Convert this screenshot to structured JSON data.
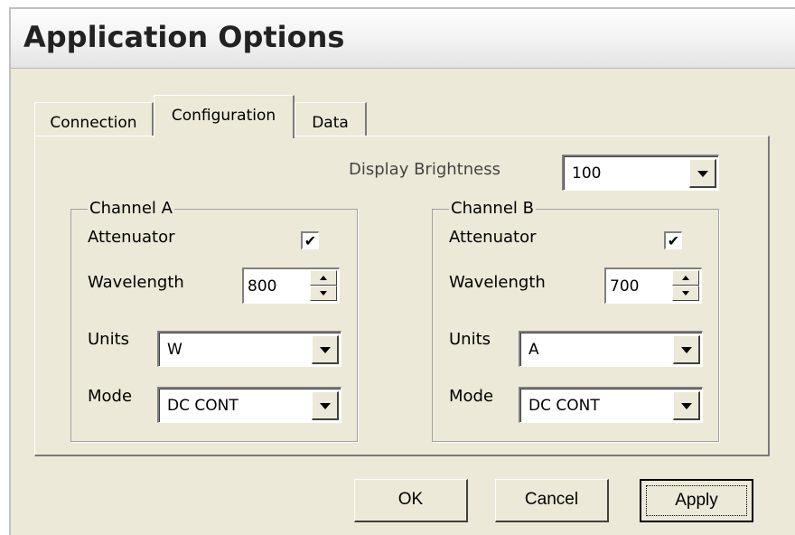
{
  "window": {
    "title": "Application Options"
  },
  "tabs": [
    {
      "label": "Connection",
      "active": false
    },
    {
      "label": "Configuration",
      "active": true
    },
    {
      "label": "Data",
      "active": false
    }
  ],
  "display_brightness": {
    "label": "Display Brightness",
    "value": "100"
  },
  "channel_a": {
    "title": "Channel A",
    "attenuator_label": "Attenuator",
    "attenuator_checked": true,
    "wavelength_label": "Wavelength",
    "wavelength_value": "800",
    "units_label": "Units",
    "units_value": "W",
    "mode_label": "Mode",
    "mode_value": "DC CONT"
  },
  "channel_b": {
    "title": "Channel B",
    "attenuator_label": "Attenuator",
    "attenuator_checked": true,
    "wavelength_label": "Wavelength",
    "wavelength_value": "700",
    "units_label": "Units",
    "units_value": "A",
    "mode_label": "Mode",
    "mode_value": "DC CONT"
  },
  "check_mark": "✔",
  "buttons": {
    "ok": "OK",
    "cancel": "Cancel",
    "apply": "Apply"
  },
  "colors": {
    "background": "#ece9d8",
    "titlebar": "#f4f4f4"
  }
}
